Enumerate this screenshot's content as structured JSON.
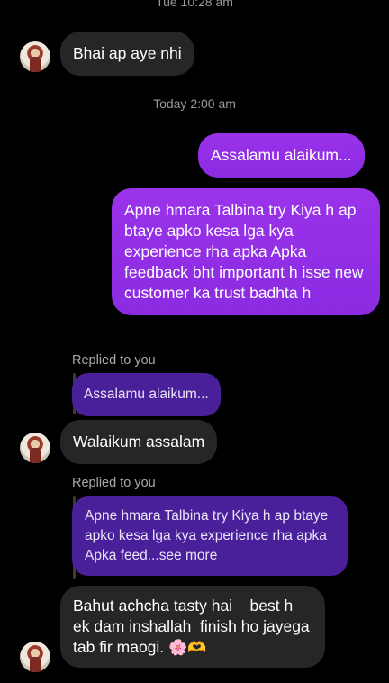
{
  "timestamps": {
    "top": "Tue 10:28 am",
    "today": "Today 2:00 am"
  },
  "messages": {
    "m1": "Bhai ap aye nhi",
    "m2": "Assalamu alaikum...",
    "m3": "Apne hmara Talbina try Kiya h ap btaye apko kesa lga kya experience rha apka Apka feedback bht important h isse new customer ka trust badhta h",
    "reply1": {
      "label": "Replied to you",
      "quote": "Assalamu alaikum...",
      "text": "Walaikum assalam"
    },
    "reply2": {
      "label": "Replied to you",
      "quote": "Apne hmara Talbina try Kiya h ap btaye apko kesa lga kya experience rha apka Apka feed...see more",
      "text": "Bahut achcha tasty hai    best h  ek dam inshallah  finish ho jayega tab fir maogi.",
      "emoji": "🌸🫶"
    }
  },
  "colors": {
    "background": "#000000",
    "incoming_bubble": "#262626",
    "outgoing_bubble": "#8a2be2",
    "quoted_bubble": "#4a1f9a"
  },
  "icons": {
    "avatar": "profile-photo-avatar"
  }
}
